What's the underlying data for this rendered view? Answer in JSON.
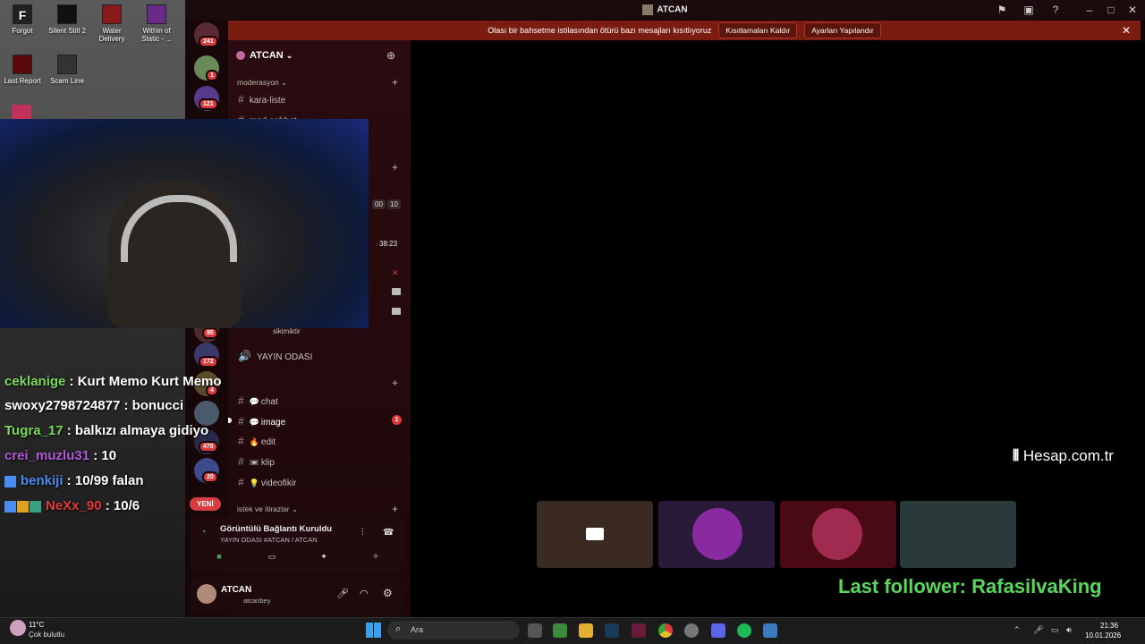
{
  "desktop": {
    "icons": [
      {
        "label": "Forgot"
      },
      {
        "label": "Silent Still 2"
      },
      {
        "label": "Water Delivery"
      },
      {
        "label": "Within of Static - ..."
      },
      {
        "label": "Last Report"
      },
      {
        "label": "Scam Line"
      }
    ]
  },
  "window": {
    "title": "ATCAN"
  },
  "notice": {
    "text": "Olası bir bahsetme istilasından ötürü bazı mesajları kısıtlıyoruz",
    "btn_remove": "Kısıtlamaları Kaldır",
    "btn_settings": "Ayarları Yapılandır"
  },
  "servers": {
    "badges": [
      "241",
      "1",
      "121",
      "95",
      "172",
      "4",
      "478",
      "20"
    ],
    "new_label": "YENİ"
  },
  "sidebar": {
    "guild_name": "ATCAN",
    "categories": {
      "moderasyon": "moderasyon",
      "istek": "istek ve itirazlar"
    },
    "channels": {
      "kara_liste": "kara-liste",
      "mod_sohbet": "mod-sohbet",
      "sikimiktir": "sikimiktir",
      "yayin_odasi": "YAYIN ODASI",
      "chat": "chat",
      "image": "image",
      "edit": "edit",
      "klip": "klip",
      "videofikir": "videofikir"
    },
    "image_badge": "1",
    "timers": [
      "00",
      "10",
      "38:23"
    ]
  },
  "voice": {
    "status": "Görüntülü Bağlantı Kuruldu",
    "location": "YAYIN ODASI #ATCAN / ATCAN"
  },
  "user": {
    "name": "ATCAN",
    "status": "atcanbey"
  },
  "overlay": {
    "brand": "Hesap.com.tr",
    "last_follower": "Last follower: RafasilvaKing"
  },
  "chat": {
    "lines": [
      {
        "user": "ceklanige",
        "text": " : Kurt Memo Kurt Memo"
      },
      {
        "user": "swoxy2798724877",
        "text": " : bonucci"
      },
      {
        "user": "Tugra_17",
        "text": " : balkızı almaya gidiyo"
      },
      {
        "user": "crei_muzlu31",
        "text": " : 10"
      },
      {
        "user": "benkiji",
        "text": " : 10/99 falan"
      },
      {
        "user": "NeXx_90",
        "text": " : 10/6"
      }
    ],
    "colors": {
      "green": "#7cd85a",
      "purple": "#b05ad8",
      "blue": "#4a8cf0",
      "red": "#e03a3a"
    }
  },
  "taskbar": {
    "weather_temp": "11°C",
    "weather_desc": "Çok bulutlu",
    "search_placeholder": "Ara",
    "time": "21:36",
    "date": "10.01.2026"
  }
}
